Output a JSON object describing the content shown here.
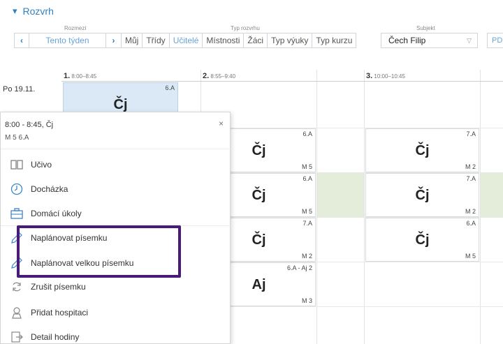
{
  "header": {
    "title": "Rozvrh"
  },
  "toolbar": {
    "rozmezi_label": "Rozmezí",
    "typ_label": "Typ rozvrhu",
    "subjekt_label": "Subjekt",
    "week_label": "Tento týden",
    "types": [
      "Můj",
      "Třídy",
      "Učitelé",
      "Místnosti",
      "Žáci",
      "Typ výuky",
      "Typ kurzu"
    ],
    "active_type": "Učitelé",
    "subject_value": "Čech Filip",
    "pdf_label": "PD"
  },
  "columns": [
    {
      "num": "1.",
      "time": "8:00–8:45"
    },
    {
      "num": "2.",
      "time": "8:55–9:40"
    },
    {
      "num": "3.",
      "time": "10:00–10:45"
    }
  ],
  "day": "Po 19.11.",
  "lessons": [
    {
      "cls": "6.A",
      "subj": "Čj",
      "room": ""
    },
    {
      "cls": "6.A",
      "subj": "Čj",
      "room": "M 5"
    },
    {
      "cls": "6.A",
      "subj": "Čj",
      "room": "M 5"
    },
    {
      "cls": "7.A",
      "subj": "Čj",
      "room": "M 2"
    },
    {
      "cls": "6.A - Aj 2",
      "subj": "Aj",
      "room": "M 3"
    },
    {
      "cls": "7.A",
      "subj": "Čj",
      "room": "M 2"
    },
    {
      "cls": "7.A",
      "subj": "Čj",
      "room": "M 2"
    },
    {
      "cls": "6.A",
      "subj": "Čj",
      "room": "M 5"
    }
  ],
  "popup": {
    "title": "8:00 - 8:45, Čj",
    "subtitle": "M 5 6.A",
    "close": "×",
    "items": [
      {
        "label": "Učivo",
        "icon": "book-icon"
      },
      {
        "label": "Docházka",
        "icon": "clock-icon"
      },
      {
        "label": "Domácí úkoly",
        "icon": "briefcase-icon"
      },
      {
        "label": "Naplánovat písemku",
        "icon": "pencil-icon"
      },
      {
        "label": "Naplánovat velkou písemku",
        "icon": "pencil-icon"
      },
      {
        "label": "Zrušit písemku",
        "icon": "refresh-icon"
      },
      {
        "label": "Přidat hospitaci",
        "icon": "person-icon"
      },
      {
        "label": "Detail hodiny",
        "icon": "exit-icon"
      }
    ]
  },
  "colors": {
    "accent": "#2f7fc1",
    "highlight_border": "#4a1a7a",
    "selected_cell": "#dbe9f6",
    "empty_cell": "#e4ecda"
  }
}
